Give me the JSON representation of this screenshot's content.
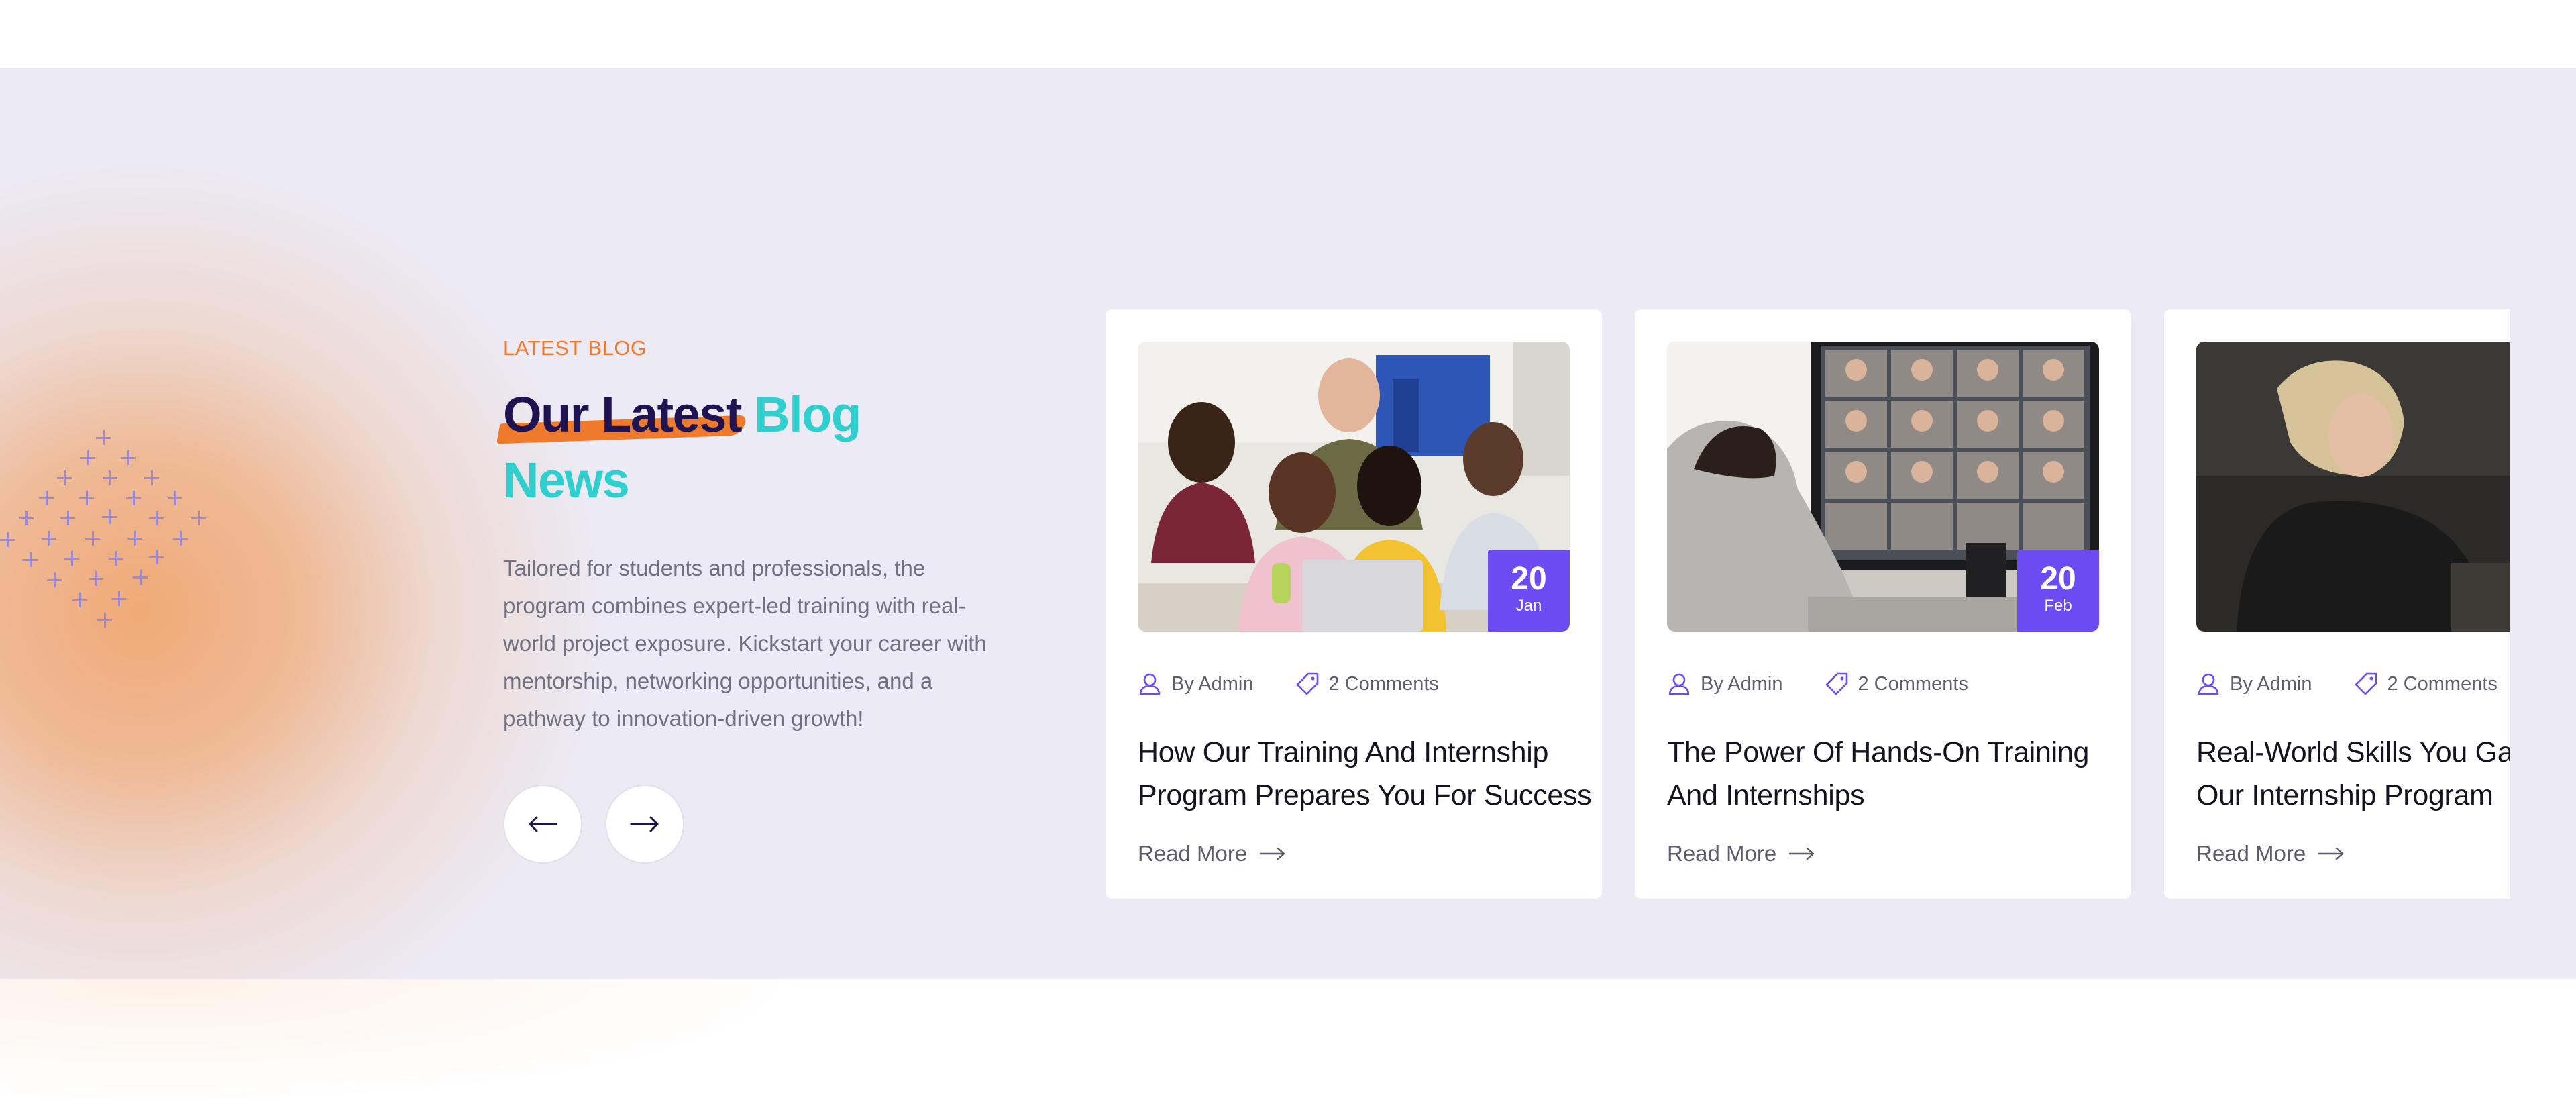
{
  "section": {
    "eyebrow": "LATEST BLOG",
    "title_dark": "Our Latest",
    "title_teal_1": "Blog",
    "title_teal_2": "News",
    "description": "Tailored for students and professionals, the program combines expert-led training with real-world project exposure. Kickstart your career with mentorship, networking opportunities, and a pathway to innovation-driven growth!",
    "prev_icon": "arrow-left-icon",
    "next_icon": "arrow-right-icon"
  },
  "cards": [
    {
      "date_day": "20",
      "date_month": "Jan",
      "author": "By Admin",
      "comments": "2 Comments",
      "title_line1": "How Our Training And Internship",
      "title_line2": "Program Prepares You For Success",
      "read_more": "Read More"
    },
    {
      "date_day": "20",
      "date_month": "Feb",
      "author": "By Admin",
      "comments": "2 Comments",
      "title_line1": "The Power Of Hands-On Training",
      "title_line2": "And Internships",
      "read_more": "Read More"
    },
    {
      "date_day": "",
      "date_month": "",
      "author": "By Admin",
      "comments": "2 Comments",
      "title_line1": "Real-World Skills You Gain",
      "title_line2": "Our Internship Program",
      "read_more": "Read More"
    }
  ],
  "colors": {
    "accent_purple": "#6c4cf2",
    "accent_orange": "#f07a2b",
    "accent_teal": "#2ecfcf",
    "title_dark": "#1f1352",
    "band_background": "#eceaf4"
  }
}
